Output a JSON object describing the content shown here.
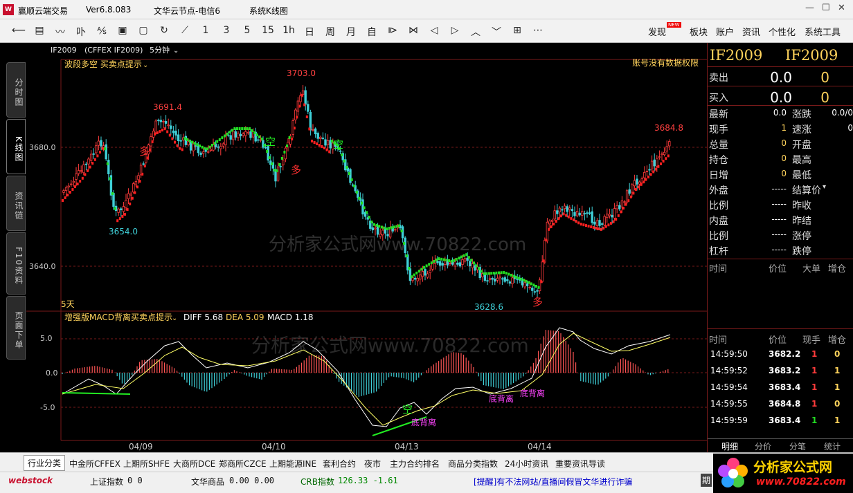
{
  "title_bar": {
    "app": "赢顺云端交易",
    "version": "Ver6.8.083",
    "server": "文华云节点-电信6",
    "mode": "系统K线图"
  },
  "toolbar": {
    "icons": [
      "back-icon",
      "list-icon",
      "line-chart-icon",
      "kline-icon",
      "wave-icon",
      "panel-icon",
      "save-icon",
      "refresh-icon",
      "draw-icon"
    ],
    "periods": [
      "1",
      "3",
      "5",
      "15",
      "1h",
      "日",
      "周",
      "月",
      "自"
    ],
    "nav_icons": [
      "zoom-in-icon",
      "zoom-out-icon",
      "left-icon",
      "right-icon",
      "up-icon",
      "down-icon",
      "grid-icon",
      "more-icon"
    ],
    "discover": "发现",
    "new_badge": "NEW",
    "menus": [
      "板块",
      "账户",
      "资讯",
      "个性化",
      "系统工具"
    ]
  },
  "left_tabs": [
    "分时图",
    "K线图",
    "资讯链",
    "F10资料",
    "页面下单"
  ],
  "chart": {
    "contract": "IF2009",
    "exchange_code": "(CFFEX IF2009)",
    "period": "5分钟",
    "indicator_main": "波段多空 买卖点提示",
    "no_permission": "账号没有数据权限",
    "price_labels": [
      "3680.0",
      "3640.0"
    ],
    "days_label": "5天",
    "peak_labels": [
      "3691.4",
      "3703.0",
      "3654.0",
      "3628.6",
      "3684.8"
    ],
    "signals": [
      "多",
      "空",
      "多",
      "空",
      "多"
    ],
    "macd_title": "增强版MACD背离买卖点提示",
    "diff": "DIFF 5.68",
    "dea": "DEA 5.09",
    "macd": "MACD 1.18",
    "macd_labels": [
      "5.0",
      "0.0",
      "-5.0"
    ],
    "divergence": [
      "底背离",
      "底背离",
      "底背离"
    ],
    "macd_sell": "空",
    "dates": [
      "04/09",
      "04/10",
      "04/13",
      "04/14"
    ],
    "watermark": "分析家公式网www.70822.com",
    "colors": {
      "up": "#ff3b3b",
      "down": "#3fd0d8",
      "bull_line": "#ff2020",
      "bear_line": "#22dd22",
      "grid": "#7a1a1a"
    }
  },
  "right_panel": {
    "code1": "IF2009",
    "code2": "IF2009",
    "sell": "卖出",
    "sell_price": "0.0",
    "sell_qty": "0",
    "buy": "买入",
    "buy_price": "0.0",
    "buy_qty": "0",
    "left_rows": [
      [
        "最新",
        "0.0"
      ],
      [
        "现手",
        "1"
      ],
      [
        "总量",
        "0"
      ],
      [
        "持仓",
        "0"
      ],
      [
        "日增",
        "0"
      ],
      [
        "外盘",
        "-----"
      ],
      [
        "比例",
        "-----"
      ],
      [
        "内盘",
        "-----"
      ],
      [
        "比例",
        "-----"
      ],
      [
        "杠杆",
        "-----"
      ]
    ],
    "right_rows": [
      "涨跌",
      "速涨",
      "开盘",
      "最高",
      "最低",
      "结算价",
      "昨收",
      "昨结",
      "涨停",
      "跌停"
    ],
    "rise_val": "0.0/0",
    "speed_val": "0",
    "cols1": [
      "时间",
      "价位",
      "大单",
      "增仓"
    ],
    "cols2": [
      "时间",
      "价位",
      "现手",
      "增仓"
    ],
    "ticks": [
      [
        "14:59:50",
        "3682.2",
        "1",
        "0"
      ],
      [
        "14:59:52",
        "3683.2",
        "1",
        "1"
      ],
      [
        "14:59:54",
        "3683.4",
        "1",
        "1"
      ],
      [
        "14:59:55",
        "3684.8",
        "1",
        "0"
      ],
      [
        "14:59:59",
        "3683.4",
        "1",
        "1"
      ]
    ],
    "tabs": [
      "明细",
      "分价",
      "分笔",
      "统计"
    ]
  },
  "bottom_tabs": [
    "行业分类",
    "中金所CFFEX",
    "上期所SHFE",
    "大商所DCE",
    "郑商所CZCE",
    "上期能源INE",
    "套利合约",
    "夜市",
    "主力合约排名",
    "商品分类指数",
    "24小时资讯",
    "重要资讯导读"
  ],
  "status": {
    "logo": "webstock",
    "sh_label": "上证指数",
    "sh_val": "0 0",
    "wh_label": "文华商品",
    "wh_val": "0.00 0.00",
    "crb_label": "CRB指数",
    "crb_val": "126.33 -1.61",
    "notice": "[提醒]有不法网站/直播间假冒文华进行诈骗",
    "brand": "分析家公式网",
    "brand_url": "www.70822.com",
    "extra": "期"
  }
}
